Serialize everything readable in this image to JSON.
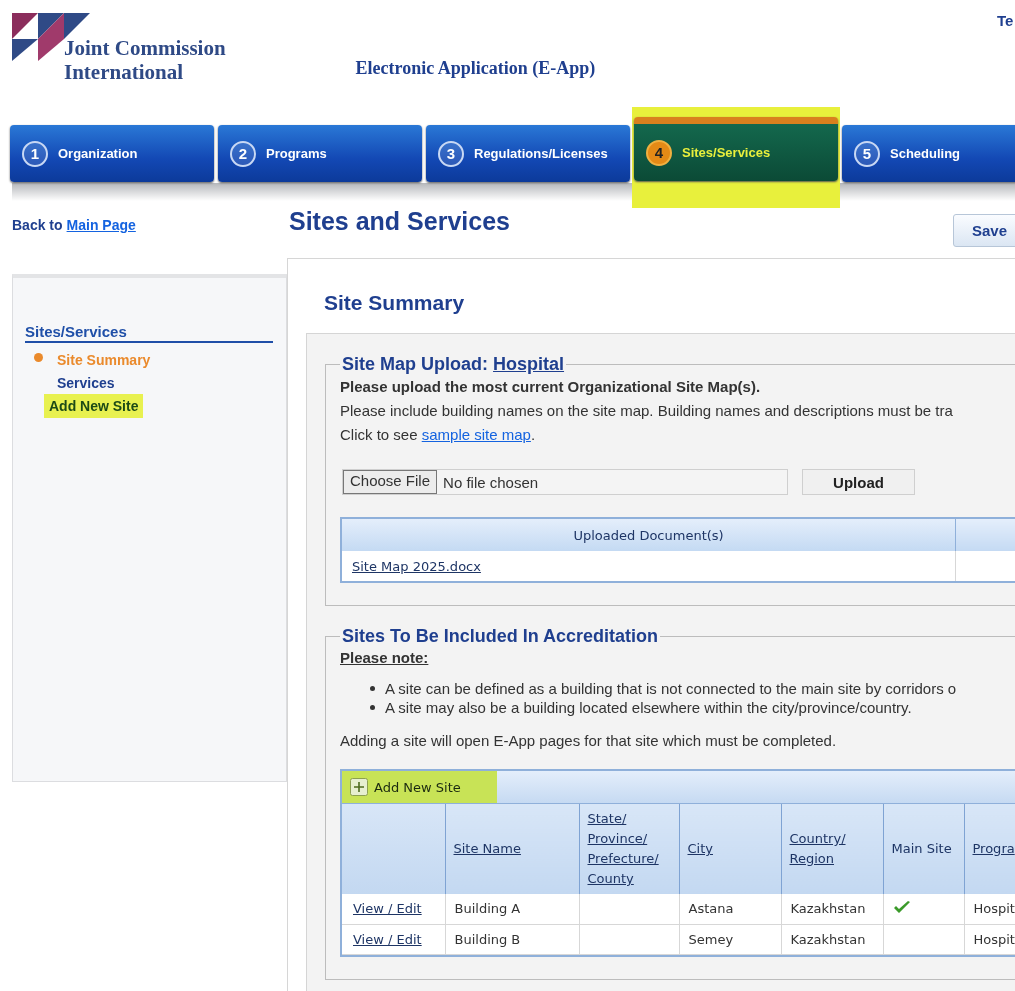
{
  "header": {
    "logo_line_1": "Joint Commission",
    "logo_line_2": "International",
    "app_title": "Electronic Application (E-App)",
    "corner_text": "Te"
  },
  "tabs": [
    {
      "number": "1",
      "label": "Organization",
      "selected": false,
      "highlighted": false
    },
    {
      "number": "2",
      "label": "Programs",
      "selected": false,
      "highlighted": false
    },
    {
      "number": "3",
      "label": "Regulations/Licenses",
      "selected": false,
      "highlighted": false
    },
    {
      "number": "4",
      "label": "Sites/Services",
      "selected": true,
      "highlighted": true
    },
    {
      "number": "5",
      "label": "Scheduling",
      "selected": false,
      "highlighted": false
    }
  ],
  "back": {
    "prefix": "Back to",
    "link": "Main Page"
  },
  "page_title": "Sites and Services",
  "save_button": "Save",
  "sidebar": {
    "heading": "Sites/Services",
    "items": [
      {
        "label": "Site Summary",
        "selected": true,
        "highlighted": false
      },
      {
        "label": "Services",
        "selected": false,
        "highlighted": false
      },
      {
        "label": "Add New Site",
        "selected": false,
        "highlighted": true
      }
    ]
  },
  "section_title": "Site Summary",
  "site_map": {
    "legend": "Site Map Upload:",
    "legend_link": "Hospital",
    "instruction": "Please upload the most current Organizational Site Map(s).",
    "note": "Please include building names on the site map. Building names and descriptions must be tra",
    "click_prefix": "Click to see",
    "click_link": "sample site map",
    "click_suffix": ".",
    "choose_button": "Choose File",
    "file_status": "No file chosen",
    "upload_button": "Upload",
    "documents_header": "Uploaded Document(s)",
    "documents": [
      "Site Map 2025.docx"
    ]
  },
  "sites": {
    "legend": "Sites To Be Included In Accreditation",
    "note_title": "Please note:",
    "bullets": [
      "A site can be defined as a building that is not connected to the main site by corridors o",
      "A site may also be a building located elsewhere within the city/province/country."
    ],
    "info": "Adding a site will open E-App pages for that site which must be completed.",
    "add_button": "Add New Site",
    "add_highlighted": true,
    "columns": [
      {
        "label": "Site Name",
        "sortable": true
      },
      {
        "label": "State/ Province/ Prefecture/ County",
        "sortable": true
      },
      {
        "label": "City",
        "sortable": true
      },
      {
        "label": "Country/ Region",
        "sortable": true
      },
      {
        "label": "Main Site",
        "sortable": false
      },
      {
        "label": "Progra",
        "sortable": true
      }
    ],
    "rows": [
      {
        "action": "View / Edit",
        "name": "Building A",
        "state": "",
        "city": "Astana",
        "country": "Kazakhstan",
        "main_site": true,
        "program": "Hospit"
      },
      {
        "action": "View / Edit",
        "name": "Building B",
        "state": "",
        "city": "Semey",
        "country": "Kazakhstan",
        "main_site": false,
        "program": "Hospit"
      }
    ]
  }
}
